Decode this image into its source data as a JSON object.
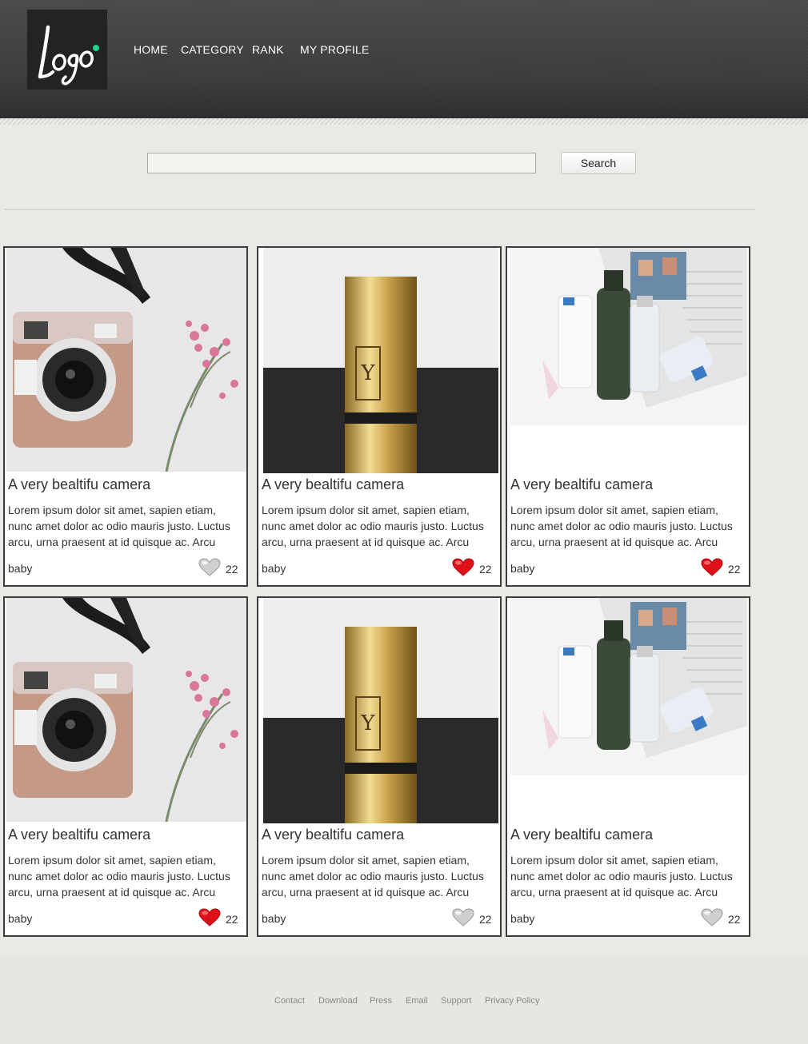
{
  "header": {
    "logo_text": "Logo",
    "nav": [
      "HOME",
      "CATEGORY",
      "RANK",
      "MY PROFILE"
    ]
  },
  "search": {
    "value": "",
    "placeholder": "",
    "button_label": "Search"
  },
  "cards": [
    {
      "title": "A very bealtifu camera",
      "desc": "Lorem ipsum dolor sit amet, sapien etiam, nunc amet dolor ac odio mauris justo. Luctus arcu, urna praesent at id quisque ac. Arcu",
      "tag": "baby",
      "likes": "22",
      "liked": false,
      "image": "camera"
    },
    {
      "title": "A very bealtifu camera",
      "desc": "Lorem ipsum dolor sit amet, sapien etiam, nunc amet dolor ac odio mauris justo. Luctus arcu, urna praesent at id quisque ac. Arcu",
      "tag": "baby",
      "likes": "22",
      "liked": true,
      "image": "lipstick"
    },
    {
      "title": "A very bealtifu camera",
      "desc": "Lorem ipsum dolor sit amet, sapien etiam, nunc amet dolor ac odio mauris justo. Luctus arcu, urna praesent at id quisque ac. Arcu",
      "tag": "baby",
      "likes": "22",
      "liked": true,
      "image": "skincare"
    },
    {
      "title": "A very bealtifu camera",
      "desc": "Lorem ipsum dolor sit amet, sapien etiam, nunc amet dolor ac odio mauris justo. Luctus arcu, urna praesent at id quisque ac. Arcu",
      "tag": "baby",
      "likes": "22",
      "liked": true,
      "image": "camera"
    },
    {
      "title": "A very bealtifu camera",
      "desc": "Lorem ipsum dolor sit amet, sapien etiam, nunc amet dolor ac odio mauris justo. Luctus arcu, urna praesent at id quisque ac. Arcu",
      "tag": "baby",
      "likes": "22",
      "liked": false,
      "image": "lipstick"
    },
    {
      "title": "A very bealtifu camera",
      "desc": "Lorem ipsum dolor sit amet, sapien etiam, nunc amet dolor ac odio mauris justo. Luctus arcu, urna praesent at id quisque ac. Arcu",
      "tag": "baby",
      "likes": "22",
      "liked": false,
      "image": "skincare"
    }
  ],
  "footer": {
    "links": [
      "Contact",
      "Download",
      "Press",
      "Email",
      "Support",
      "Privacy Policy"
    ]
  },
  "colors": {
    "header": "#3f3f3f",
    "heart_liked": "#e0101a",
    "heart_unliked": "#c8c8c8",
    "card_border": "#3d3d3d"
  }
}
